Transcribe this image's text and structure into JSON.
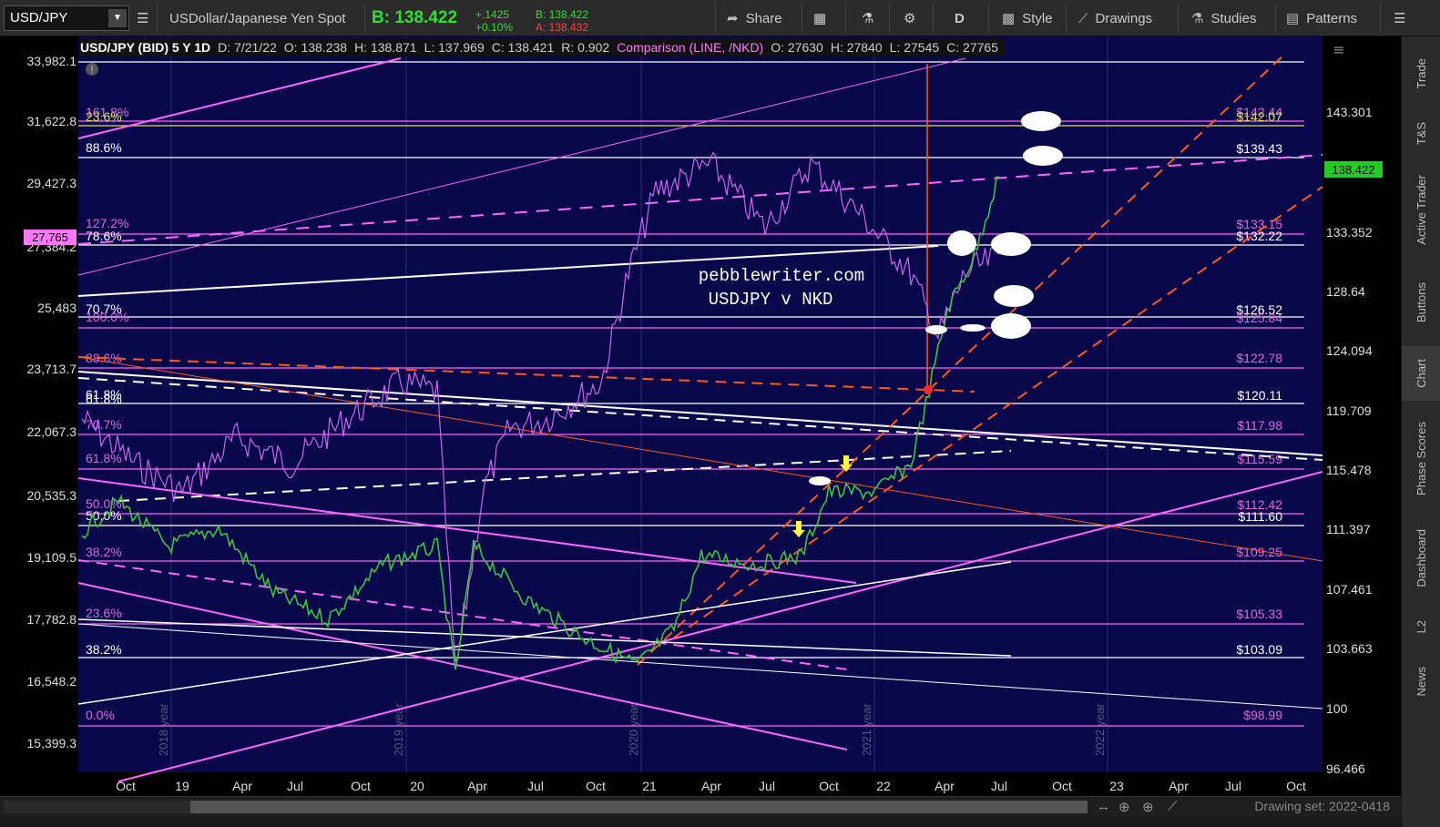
{
  "toolbar": {
    "symbol": "USD/JPY",
    "description": "USDollar/Japanese Yen Spot",
    "bid_label": "B: 138.422",
    "change_abs": "+.1425",
    "change_pct": "+0.10%",
    "bid_small": "B: 138.422",
    "ask_small": "A: 138.432",
    "share": "Share",
    "timeframe": "D",
    "style": "Style",
    "drawings": "Drawings",
    "studies": "Studies",
    "patterns": "Patterns"
  },
  "legend": {
    "main": "USD/JPY (BID) 5 Y 1D",
    "date": "D: 7/21/22",
    "open": "O: 138.238",
    "high": "H: 138.871",
    "low": "L: 137.969",
    "close": "C: 138.421",
    "range": "R: 0.902",
    "comp": "Comparison (LINE, /NKD)",
    "comp_open": "O: 27630",
    "comp_high": "H: 27840",
    "comp_low": "L: 27545",
    "comp_close": "C: 27765"
  },
  "watermark": {
    "line1": "pebblewriter.com",
    "line2": "USDJPY v NKD"
  },
  "left_axis": [
    "33,982.1",
    "31,622.8",
    "29,427.3",
    "27,384.2",
    "25,483",
    "23,713.7",
    "22,067.3",
    "20,535.3",
    "19,109.5",
    "17,782.8",
    "16,548.2",
    "15,399.3"
  ],
  "left_axis_marker": "27,765",
  "right_axis": [
    "143.301",
    "133.352",
    "128.64",
    "124.094",
    "119.709",
    "115.478",
    "111.397",
    "107.461",
    "103.663",
    "100",
    "96.466"
  ],
  "right_axis_marker": "138.422",
  "x_axis": [
    "Oct",
    "19",
    "Apr",
    "Jul",
    "Oct",
    "20",
    "Apr",
    "Jul",
    "Oct",
    "21",
    "Apr",
    "Jul",
    "Oct",
    "22",
    "Apr",
    "Jul",
    "Oct",
    "23",
    "Apr",
    "Jul",
    "Oct"
  ],
  "year_marks": [
    "2018 year",
    "2019 year",
    "2020 year",
    "2021 year",
    "2022 year"
  ],
  "fib_left": [
    {
      "text": "161.8%",
      "color": "#e066e0"
    },
    {
      "text": "23.6%",
      "color": "#e0e040"
    },
    {
      "text": "88.6%",
      "color": "#ffffff"
    },
    {
      "text": "127.2%",
      "color": "#e066e0"
    },
    {
      "text": "78.6%",
      "color": "#ffffff"
    },
    {
      "text": "70.7%",
      "color": "#ffffff"
    },
    {
      "text": "100.0%",
      "color": "#e066e0"
    },
    {
      "text": "88.6%",
      "color": "#e066e0"
    },
    {
      "text": "61.8%",
      "color": "#ffffff"
    },
    {
      "text": "61.8%",
      "color": "#ffffff"
    },
    {
      "text": "70.7%",
      "color": "#e066e0"
    },
    {
      "text": "61.8%",
      "color": "#e066e0"
    },
    {
      "text": "50.0%",
      "color": "#e066e0"
    },
    {
      "text": "50.0%",
      "color": "#ffffff"
    },
    {
      "text": "38.2%",
      "color": "#e066e0"
    },
    {
      "text": "23.6%",
      "color": "#e066e0"
    },
    {
      "text": "38.2%",
      "color": "#ffffff"
    },
    {
      "text": "0.0%",
      "color": "#e066e0"
    }
  ],
  "fib_right": [
    {
      "text": "$142.44",
      "color": "#e066e0"
    },
    {
      "text": "$142.07",
      "color": "#e0e040"
    },
    {
      "text": "$139.43",
      "color": "#ffffff"
    },
    {
      "text": "$133.15",
      "color": "#e066e0"
    },
    {
      "text": "$132.22",
      "color": "#ffffff"
    },
    {
      "text": "$126.52",
      "color": "#ffffff"
    },
    {
      "text": "$125.84",
      "color": "#e066e0"
    },
    {
      "text": "$122.78",
      "color": "#e066e0"
    },
    {
      "text": "$120.11",
      "color": "#ffffff"
    },
    {
      "text": "$117.98",
      "color": "#e066e0"
    },
    {
      "text": "$115.59",
      "color": "#e066e0"
    },
    {
      "text": "$112.42",
      "color": "#e066e0"
    },
    {
      "text": "$111.60",
      "color": "#ffffff"
    },
    {
      "text": "$109.25",
      "color": "#e066e0"
    },
    {
      "text": "$105.33",
      "color": "#e066e0"
    },
    {
      "text": "$103.09",
      "color": "#ffffff"
    },
    {
      "text": "$98.99",
      "color": "#e066e0"
    }
  ],
  "sidebar": [
    "Trade",
    "T&S",
    "Active Trader",
    "Buttons",
    "Chart",
    "Phase Scores",
    "Dashboard",
    "L2",
    "News"
  ],
  "bottom": {
    "drawing_set": "Drawing set: 2022-0418"
  },
  "colors": {
    "chart_bg": "#07074a",
    "up": "#3ec43e",
    "down": "#d83a3a",
    "comparison": "#cc66ee",
    "fib_magenta": "#ff66ff",
    "trend_orange": "#ff5a1a",
    "accent_green": "#22cc22"
  }
}
